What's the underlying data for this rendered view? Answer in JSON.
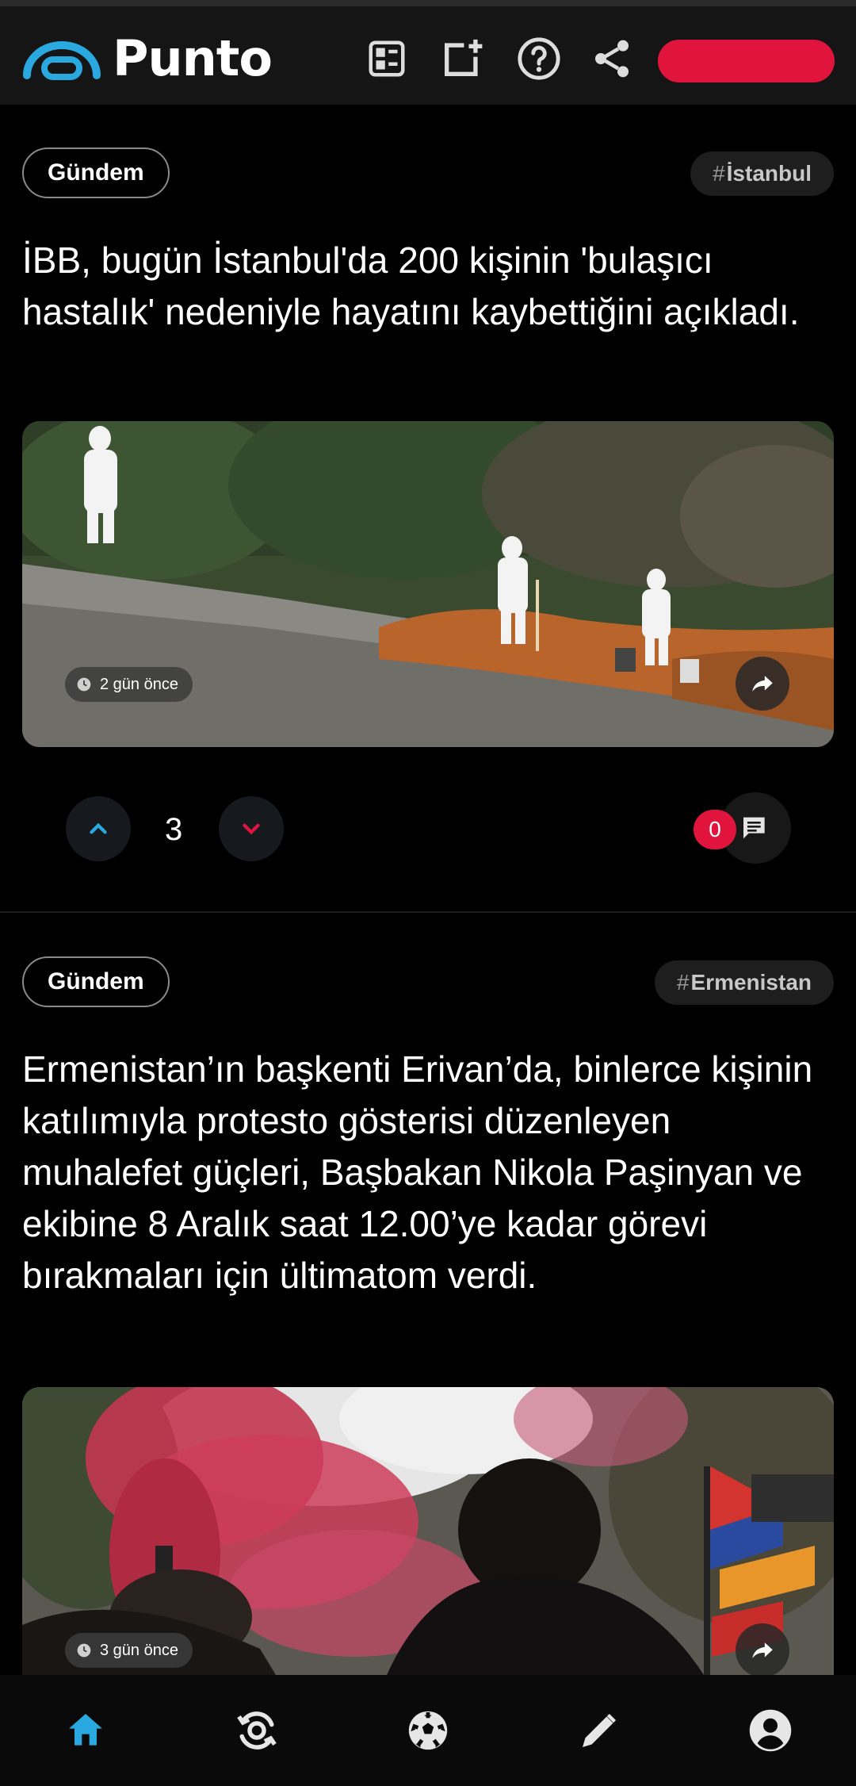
{
  "app": {
    "name": "Punto",
    "accent_color": "#29a9e0",
    "alert_color": "#e0143c"
  },
  "header": {
    "icons": [
      "layout-icon",
      "add-post-icon",
      "help-icon",
      "share-icon"
    ],
    "action_pill_label": ""
  },
  "feed": [
    {
      "category": "Gündem",
      "tag": "İstanbul",
      "headline": "İBB, bugün İstanbul'da 200 kişinin 'bulaşıcı hastalık' nedeniyle hayatını kaybettiğini açıkladı.",
      "time": "2 gün önce",
      "votes": "3",
      "comments": "0"
    },
    {
      "category": "Gündem",
      "tag": "Ermenistan",
      "headline": "Ermenistan’ın başkenti Erivan’da, binlerce kişinin katılımıyla protesto gösterisi düzenleyen muhalefet güçleri, Başbakan Nikola Paşinyan ve ekibine 8 Aralık saat 12.00’ye kadar görevi bırakmaları için ültimatom verdi.",
      "time": "3 gün önce"
    }
  ],
  "bottom_nav": {
    "items": [
      "home-icon",
      "explore-icon",
      "sports-icon",
      "write-icon",
      "profile-icon"
    ],
    "active": "home-icon"
  }
}
